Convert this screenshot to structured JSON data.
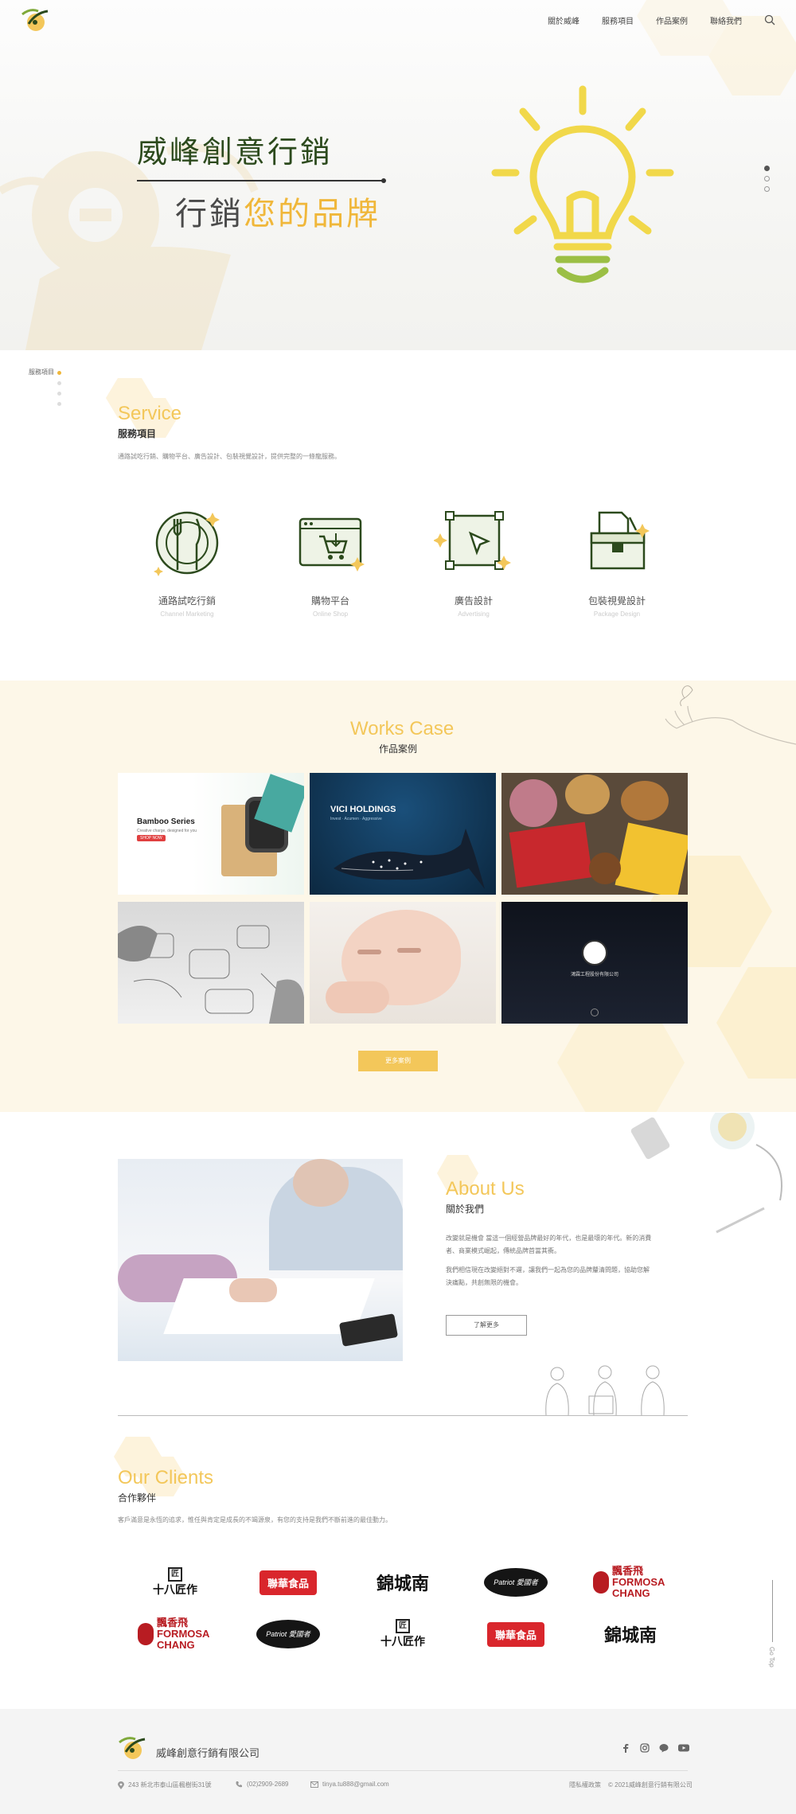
{
  "header": {
    "nav": [
      "關於威峰",
      "服務項目",
      "作品案例",
      "聯絡我們"
    ],
    "search_icon": "search-icon"
  },
  "hero": {
    "title": "威峰創意行銷",
    "subtitle_plain": "行銷",
    "subtitle_highlight": "您的品牌",
    "slides": 3,
    "active_slide": 1
  },
  "side_index": {
    "label": "服務項目"
  },
  "service": {
    "en": "Service",
    "zh": "服務項目",
    "desc": "通路試吃行銷、購物平台、廣告設計、包裝視覺設計，提供完整的一條龍服務。",
    "items": [
      {
        "zh": "通路試吃行銷",
        "en": "Channel Marketing",
        "icon": "plate-cutlery-icon"
      },
      {
        "zh": "購物平台",
        "en": "Online Shop",
        "icon": "online-cart-icon"
      },
      {
        "zh": "廣告設計",
        "en": "Advertising",
        "icon": "vector-cursor-icon"
      },
      {
        "zh": "包裝視覺設計",
        "en": "Package Design",
        "icon": "package-box-icon"
      }
    ]
  },
  "works": {
    "en": "Works Case",
    "zh": "作品案例",
    "cases": [
      {
        "title": "Bamboo Series",
        "tagline": "Creative charge, designed for you",
        "button": "SHOP NOW"
      },
      {
        "title": "VICI HOLDINGS",
        "tagline": "Invest · Acumen · Aggressive"
      },
      {
        "title": ""
      },
      {
        "title": ""
      },
      {
        "title": ""
      },
      {
        "title": "鴻霖工程股份有限公司"
      }
    ],
    "more_button": "更多案例"
  },
  "about": {
    "en": "About Us",
    "zh": "關於我們",
    "p1": "改變就是機會 當這一個經營品牌最好的年代，也是最壞的年代。新的消費者、商業模式崛起，傳統品牌首當其衝。",
    "p2": "我們相信現在改變絕對不遲，讓我們一起為您的品牌釐清問題，協助您解決痛點，共創無限的機會。",
    "button": "了解更多"
  },
  "clients": {
    "en": "Our Clients",
    "zh": "合作夥伴",
    "desc": "客戶滿意是永恆的追求，惟任與肯定是成長的不竭源泉，有您的支持是我們不斷前進的最佳動力。",
    "row1": [
      "十八匠作",
      "聯華食品",
      "錦城南",
      "Patriot 愛國者",
      "飄香飛 FORMOSA CHANG"
    ],
    "row2": [
      "飄香飛 FORMOSA CHANG",
      "Patriot 愛國者",
      "十八匠作",
      "聯華食品",
      "錦城南"
    ],
    "go_top": "Go Top"
  },
  "footer": {
    "company": "威峰創意行銷有限公司",
    "address": "243 新北市泰山區楓樹街31號",
    "phone": "(02)2909-2689",
    "email": "tinya.tu888@gmail.com",
    "privacy": "隱私權政策",
    "copyright": "© 2021威峰創意行銷有限公司",
    "social": [
      "facebook-icon",
      "instagram-icon",
      "line-icon",
      "youtube-icon"
    ]
  },
  "colors": {
    "accent": "#f3c75a",
    "brand_green": "#2c4a1d",
    "works_bg": "#fdf7e8",
    "footer_bg": "#f4f4f4"
  }
}
